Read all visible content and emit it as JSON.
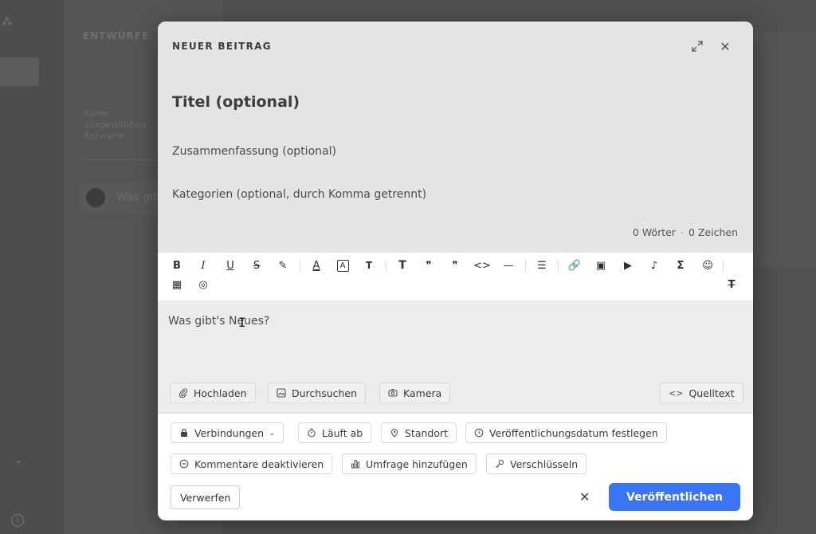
{
  "background": {
    "panel_title": "ENTWÜRFE",
    "panel_text": "Keine ausgewählten Entwürfe",
    "entry_preview": "Was gib"
  },
  "modal": {
    "title": "NEUER BEITRAG",
    "expand_icon": "expand-icon",
    "close_icon": "close-icon",
    "title_placeholder": "Titel (optional)",
    "summary_placeholder": "Zusammenfassung (optional)",
    "categories_placeholder": "Kategorien (optional, durch Komma getrennt)",
    "word_count": "0 Wörter",
    "char_count": "0 Zeichen"
  },
  "toolbar": {
    "buttons": [
      {
        "name": "bold",
        "glyph": "B"
      },
      {
        "name": "italic",
        "glyph": "I"
      },
      {
        "name": "underline",
        "glyph": "U"
      },
      {
        "name": "strikethrough",
        "glyph": "S"
      },
      {
        "name": "highlight",
        "glyph": "✎"
      },
      {
        "name": "text-color",
        "glyph": "A"
      },
      {
        "name": "background-color",
        "glyph": "A"
      },
      {
        "name": "font-size",
        "glyph": "T"
      },
      {
        "name": "heading",
        "glyph": "T"
      },
      {
        "name": "quote-block",
        "glyph": "❞"
      },
      {
        "name": "quote",
        "glyph": "❞"
      },
      {
        "name": "code",
        "glyph": "<>"
      },
      {
        "name": "horizontal-rule",
        "glyph": "—"
      },
      {
        "name": "list",
        "glyph": "☰"
      },
      {
        "name": "link",
        "glyph": "🔗"
      },
      {
        "name": "image",
        "glyph": "▣"
      },
      {
        "name": "video",
        "glyph": "▶"
      },
      {
        "name": "audio",
        "glyph": "♪"
      },
      {
        "name": "formula",
        "glyph": "Σ"
      },
      {
        "name": "emoji",
        "glyph": "☺"
      },
      {
        "name": "table",
        "glyph": "▦"
      },
      {
        "name": "spoiler",
        "glyph": "◎"
      },
      {
        "name": "clear-format",
        "glyph": "T"
      }
    ]
  },
  "editor": {
    "placeholder": "Was gibt's Neues?"
  },
  "attach": {
    "upload": "Hochladen",
    "browse": "Durchsuchen",
    "camera": "Kamera",
    "source": "Quelltext"
  },
  "options": {
    "connections": "Verbindungen",
    "expires": "Läuft ab",
    "location": "Standort",
    "schedule": "Veröffentlichungsdatum festlegen",
    "disable_comments": "Kommentare deaktivieren",
    "add_poll": "Umfrage hinzufügen",
    "encrypt": "Verschlüsseln"
  },
  "footer": {
    "discard": "Verwerfen",
    "publish": "Veröffentlichen"
  },
  "colors": {
    "accent": "#3a74f0",
    "overlay": "#505050"
  }
}
